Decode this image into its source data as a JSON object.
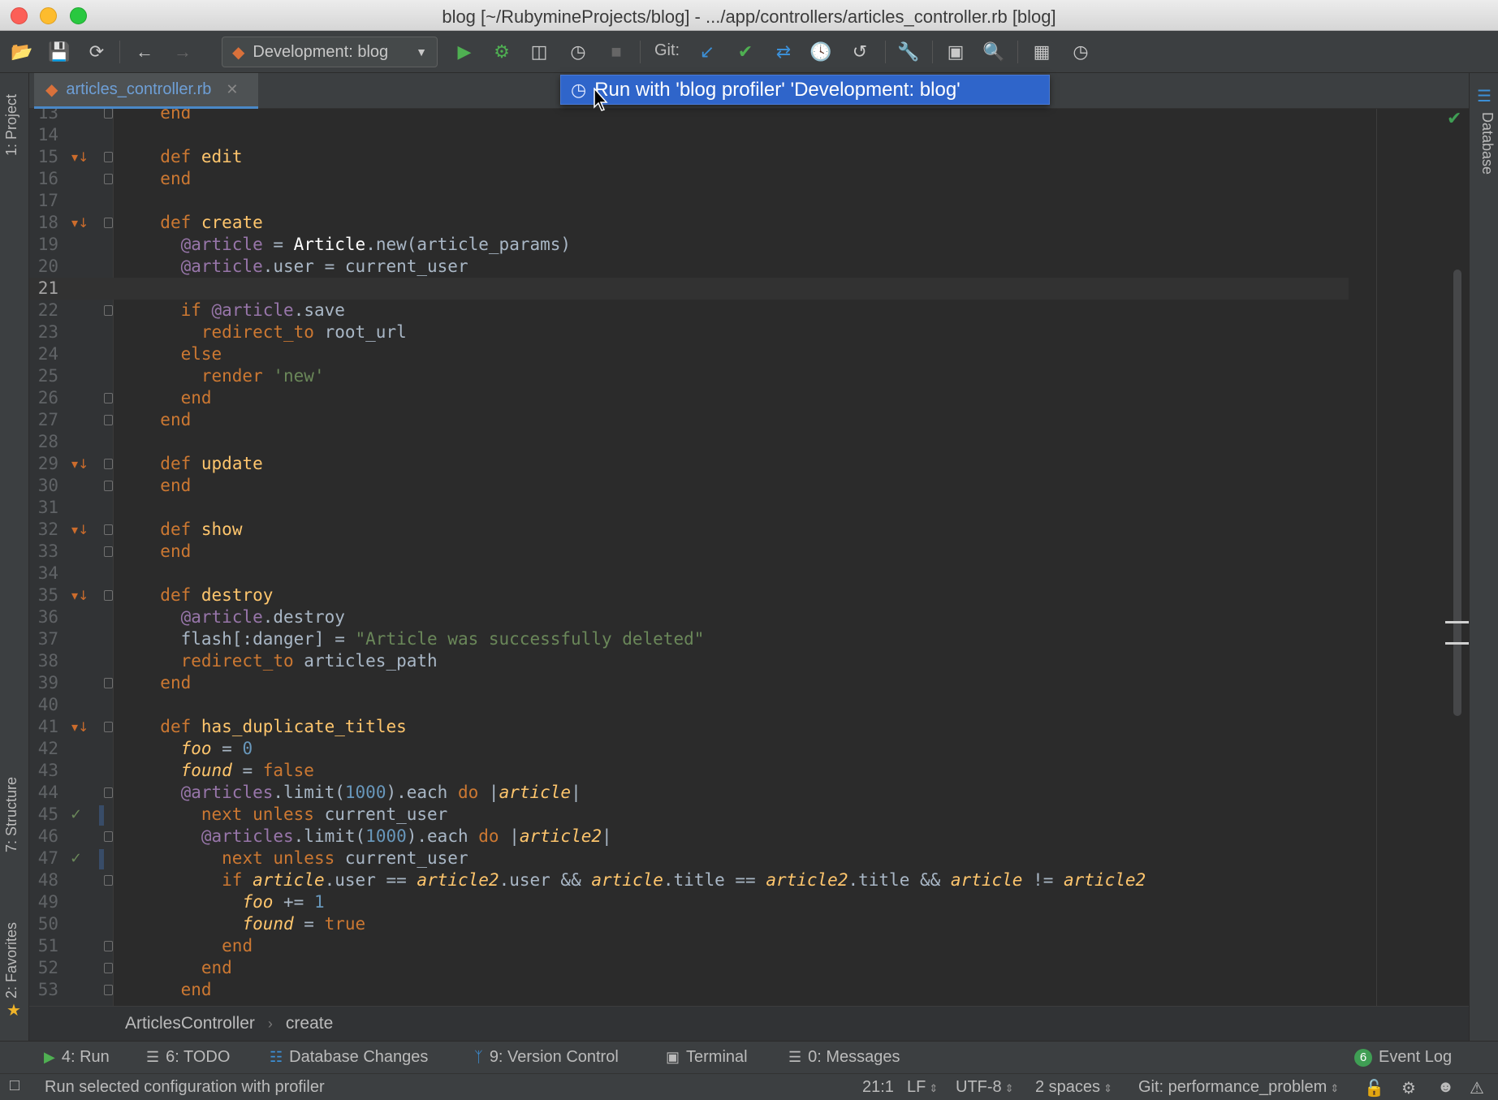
{
  "window": {
    "title": "blog [~/RubymineProjects/blog] - .../app/controllers/articles_controller.rb [blog]"
  },
  "toolbar": {
    "run_config": "Development: blog",
    "git_label": "Git:"
  },
  "left_tools": {
    "project": "1: Project",
    "structure": "7: Structure",
    "favorites": "2: Favorites"
  },
  "right_tools": {
    "database": "Database"
  },
  "tabs": [
    {
      "label": "articles_controller.rb",
      "active": true
    }
  ],
  "popup": {
    "label": "Run with 'blog profiler' 'Development: blog'"
  },
  "code": [
    {
      "n": "13",
      "html": "  <span class='k'>end</span>"
    },
    {
      "n": "14",
      "html": ""
    },
    {
      "n": "15",
      "html": "  <span class='k'>def</span> <span class='fn'>edit</span>",
      "mark": "override"
    },
    {
      "n": "16",
      "html": "  <span class='k'>end</span>"
    },
    {
      "n": "17",
      "html": ""
    },
    {
      "n": "18",
      "html": "  <span class='k'>def</span> <span class='fn'>create</span>",
      "mark": "override"
    },
    {
      "n": "19",
      "html": "    <span class='iv'>@article</span> = <span class='cn'>Article</span>.new(article_params)"
    },
    {
      "n": "20",
      "html": "    <span class='iv'>@article</span>.user = current_user"
    },
    {
      "n": "21",
      "html": "",
      "current": true
    },
    {
      "n": "22",
      "html": "    <span class='k'>if</span> <span class='iv'>@article</span>.save"
    },
    {
      "n": "23",
      "html": "      <span class='k'>redirect_to</span> root_url"
    },
    {
      "n": "24",
      "html": "    <span class='k'>else</span>"
    },
    {
      "n": "25",
      "html": "      <span class='k'>render</span> <span class='s'>'new'</span>"
    },
    {
      "n": "26",
      "html": "    <span class='k'>end</span>"
    },
    {
      "n": "27",
      "html": "  <span class='k'>end</span>"
    },
    {
      "n": "28",
      "html": ""
    },
    {
      "n": "29",
      "html": "  <span class='k'>def</span> <span class='fn'>update</span>",
      "mark": "override"
    },
    {
      "n": "30",
      "html": "  <span class='k'>end</span>"
    },
    {
      "n": "31",
      "html": ""
    },
    {
      "n": "32",
      "html": "  <span class='k'>def</span> <span class='fn'>show</span>",
      "mark": "override"
    },
    {
      "n": "33",
      "html": "  <span class='k'>end</span>"
    },
    {
      "n": "34",
      "html": ""
    },
    {
      "n": "35",
      "html": "  <span class='k'>def</span> <span class='fn'>destroy</span>",
      "mark": "override"
    },
    {
      "n": "36",
      "html": "    <span class='iv'>@article</span>.destroy"
    },
    {
      "n": "37",
      "html": "    flash[:danger] = <span class='s'>\"Article was successfully deleted\"</span>"
    },
    {
      "n": "38",
      "html": "    <span class='k'>redirect_to</span> articles_path"
    },
    {
      "n": "39",
      "html": "  <span class='k'>end</span>"
    },
    {
      "n": "40",
      "html": ""
    },
    {
      "n": "41",
      "html": "  <span class='k'>def</span> <span class='fn'>has_duplicate_titles</span>",
      "mark": "override"
    },
    {
      "n": "42",
      "html": "    <span class='lv'>foo</span> = <span class='n'>0</span>"
    },
    {
      "n": "43",
      "html": "    <span class='lv'>found</span> = <span class='k'>false</span>"
    },
    {
      "n": "44",
      "html": "    <span class='iv'>@articles</span>.limit(<span class='n'>1000</span>).each <span class='k'>do</span> |<span class='lv'>article</span>|"
    },
    {
      "n": "45",
      "html": "      <span class='k'>next unless</span> current_user",
      "mark": "check"
    },
    {
      "n": "46",
      "html": "      <span class='iv'>@articles</span>.limit(<span class='n'>1000</span>).each <span class='k'>do</span> |<span class='lv'>article2</span>|"
    },
    {
      "n": "47",
      "html": "        <span class='k'>next unless</span> current_user",
      "mark": "check"
    },
    {
      "n": "48",
      "html": "        <span class='k'>if</span> <span class='lv'>article</span>.user == <span class='lv'>article2</span>.user &amp;&amp; <span class='lv'>article</span>.title == <span class='lv'>article2</span>.title &amp;&amp; <span class='lv'>article</span> != <span class='lv'>article2</span>"
    },
    {
      "n": "49",
      "html": "          <span class='lv'>foo</span> += <span class='n'>1</span>"
    },
    {
      "n": "50",
      "html": "          <span class='lv'>found</span> = <span class='k'>true</span>"
    },
    {
      "n": "51",
      "html": "        <span class='k'>end</span>"
    },
    {
      "n": "52",
      "html": "      <span class='k'>end</span>"
    },
    {
      "n": "53",
      "html": "    <span class='k'>end</span>"
    }
  ],
  "breadcrumb": [
    "ArticlesController",
    "create"
  ],
  "toolwindows": {
    "run": "4: Run",
    "todo": "6: TODO",
    "db_changes": "Database Changes",
    "vcs": "9: Version Control",
    "terminal": "Terminal",
    "messages": "0: Messages",
    "event_log": "Event Log",
    "event_count": "6"
  },
  "status": {
    "message": "Run selected configuration with profiler",
    "position": "21:1",
    "line_sep": "LF",
    "encoding": "UTF-8",
    "indent": "2 spaces",
    "branch": "Git: performance_problem"
  }
}
